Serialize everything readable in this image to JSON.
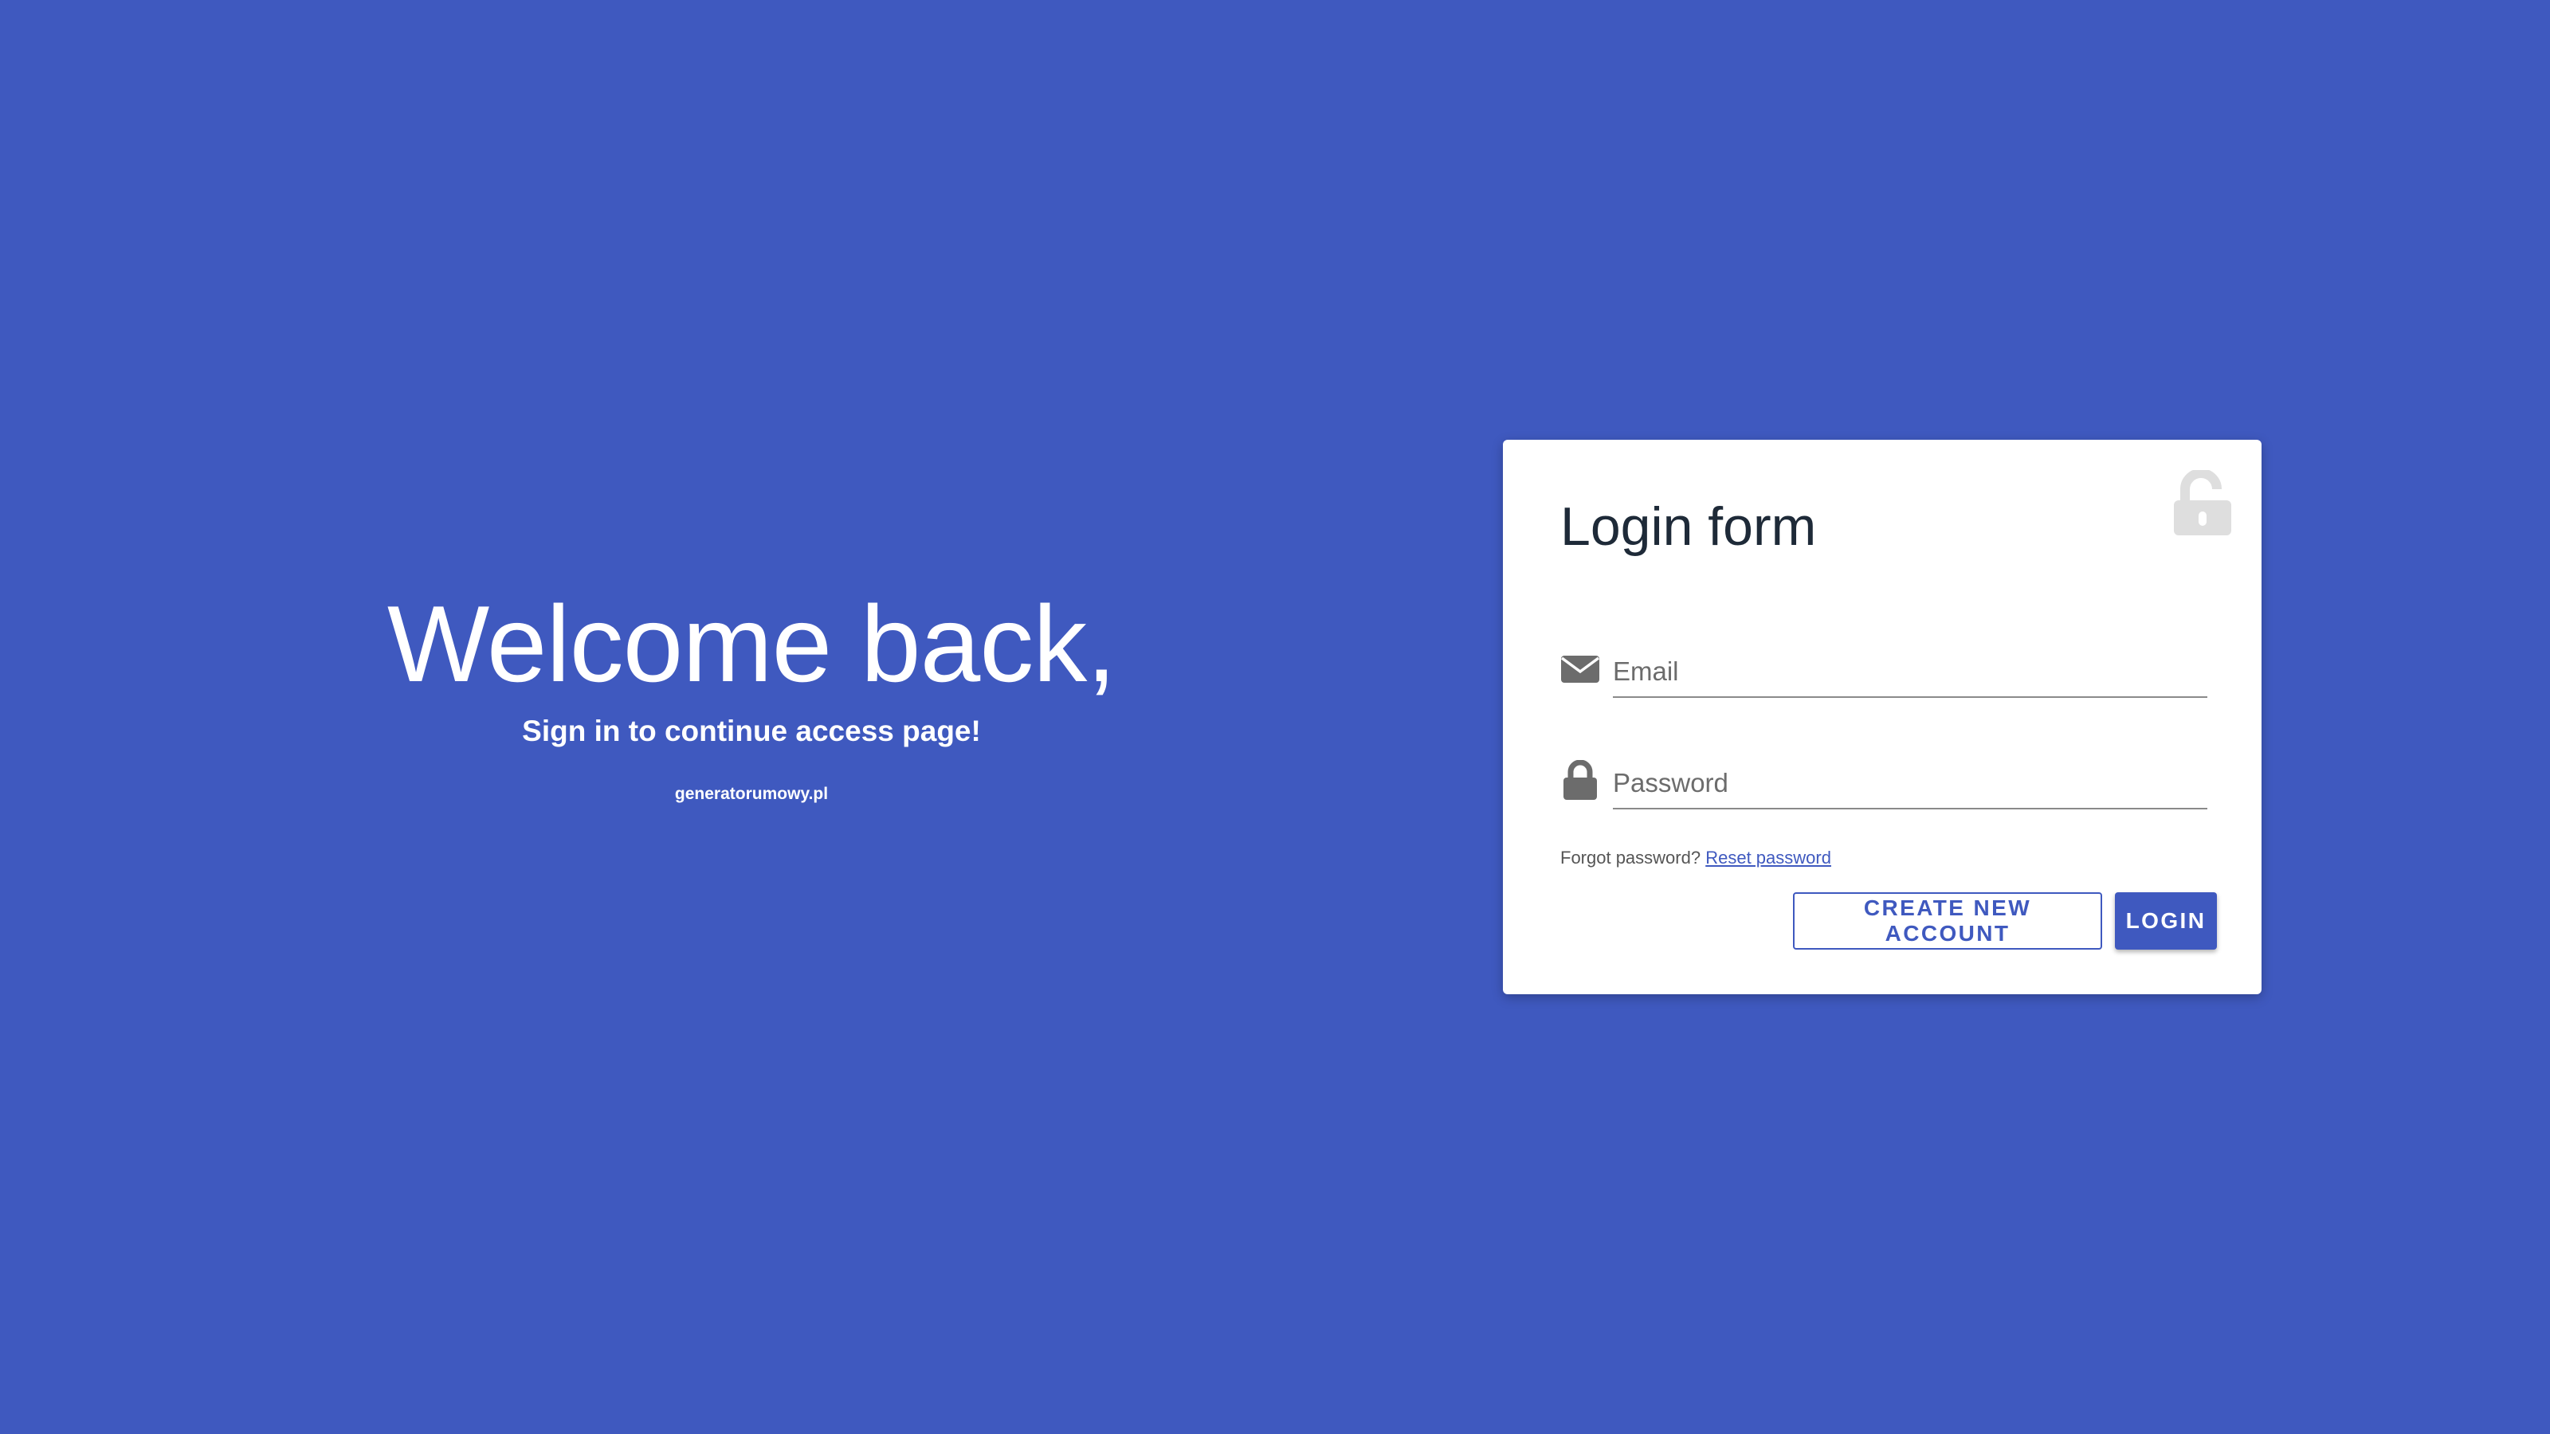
{
  "welcome": {
    "title": "Welcome back,",
    "subtitle": "Sign in to continue access page!",
    "site": "generatorumowy.pl"
  },
  "login_form": {
    "title": "Login form",
    "header_icon": "unlock-icon",
    "email": {
      "placeholder": "Email",
      "value": "",
      "icon": "envelope-icon"
    },
    "password": {
      "placeholder": "Password",
      "value": "",
      "icon": "lock-icon"
    },
    "forgot_text": "Forgot password?",
    "reset_link": "Reset password",
    "create_account_label": "CREATE NEW ACCOUNT",
    "login_label": "LOGIN"
  },
  "colors": {
    "background": "#3f59bf",
    "card": "#ffffff",
    "accent": "#3f59bf",
    "title_text": "#1e2a38",
    "icon_gray": "#6c6c6c",
    "header_icon_gray": "#dedede"
  }
}
